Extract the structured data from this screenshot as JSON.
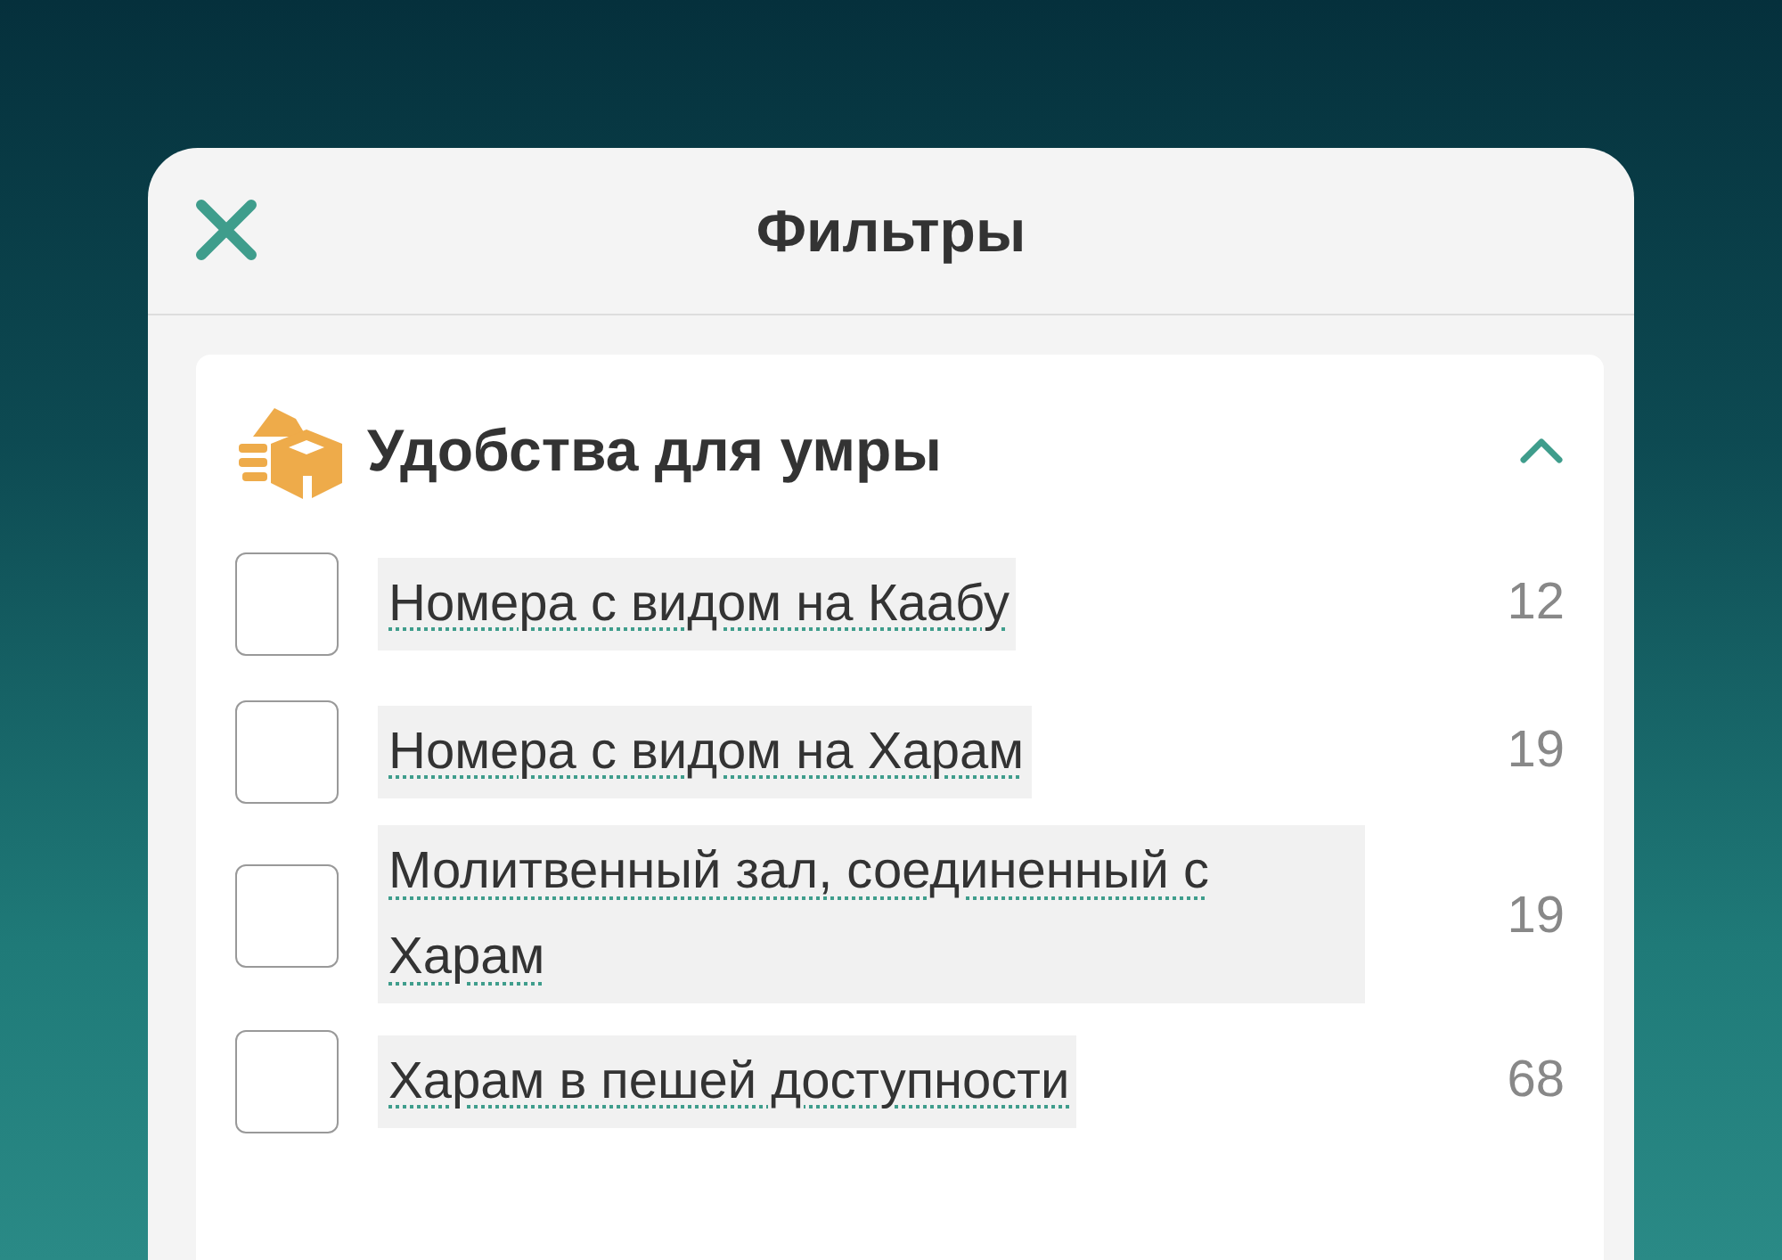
{
  "header": {
    "title": "Фильтры"
  },
  "section": {
    "title": "Удобства для умры",
    "expanded": true,
    "options": [
      {
        "label": "Номера с видом на Каабу",
        "count": "12",
        "checked": false
      },
      {
        "label": "Номера с видом на Харам",
        "count": "19",
        "checked": false
      },
      {
        "label": "Молитвенный зал, соединенный с Харам",
        "count": "19",
        "checked": false
      },
      {
        "label": "Харам в пешей доступности",
        "count": "68",
        "checked": false
      }
    ]
  }
}
